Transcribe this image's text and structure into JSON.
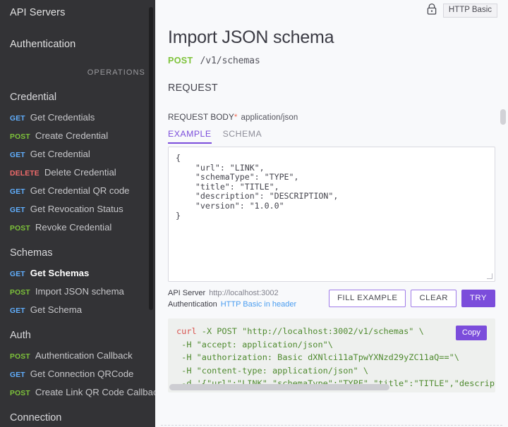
{
  "sidebar": {
    "top_items": [
      {
        "label": "API Servers"
      },
      {
        "label": "Authentication"
      }
    ],
    "operations_label": "OPERATIONS",
    "groups": [
      {
        "title": "Credential",
        "items": [
          {
            "verb": "GET",
            "label": "Get Credentials",
            "active": false
          },
          {
            "verb": "POST",
            "label": "Create Credential",
            "active": false
          },
          {
            "verb": "GET",
            "label": "Get Credential",
            "active": false
          },
          {
            "verb": "DELETE",
            "label": "Delete Credential",
            "active": false
          },
          {
            "verb": "GET",
            "label": "Get Credential QR code",
            "active": false
          },
          {
            "verb": "GET",
            "label": "Get Revocation Status",
            "active": false
          },
          {
            "verb": "POST",
            "label": "Revoke Credential",
            "active": false
          }
        ]
      },
      {
        "title": "Schemas",
        "items": [
          {
            "verb": "GET",
            "label": "Get Schemas",
            "active": true
          },
          {
            "verb": "POST",
            "label": "Import JSON schema",
            "active": false
          },
          {
            "verb": "GET",
            "label": "Get Schema",
            "active": false
          }
        ]
      },
      {
        "title": "Auth",
        "items": [
          {
            "verb": "POST",
            "label": "Authentication Callback",
            "active": false
          },
          {
            "verb": "GET",
            "label": "Get Connection QRCode",
            "active": false
          },
          {
            "verb": "POST",
            "label": "Create Link QR Code Callback",
            "active": false
          }
        ]
      },
      {
        "title": "Connection",
        "items": []
      }
    ]
  },
  "main": {
    "auth": {
      "icon": "lock-icon",
      "chip_label": "HTTP Basic"
    },
    "title": "Import JSON schema",
    "endpoint": {
      "method": "POST",
      "path": "/v1/schemas"
    },
    "request_heading": "REQUEST",
    "request_body": {
      "label": "REQUEST BODY",
      "required_marker": "*",
      "content_type": "application/json"
    },
    "tabs": [
      {
        "label": "EXAMPLE",
        "active": true
      },
      {
        "label": "SCHEMA",
        "active": false
      }
    ],
    "example_body": "{\n    \"url\": \"LINK\",\n    \"schemaType\": \"TYPE\",\n    \"title\": \"TITLE\",\n    \"description\": \"DESCRIPTION\",\n    \"version\": \"1.0.0\"\n}",
    "meta": {
      "server_label": "API Server",
      "server_value": "http://localhost:3002",
      "auth_label": "Authentication",
      "auth_value": "HTTP Basic in header"
    },
    "buttons": {
      "fill_example": "FILL EXAMPLE",
      "clear": "CLEAR",
      "try": "TRY"
    },
    "code": {
      "copy_label": "Copy",
      "line1_cmd": "curl",
      "line1_rest": " -X POST \"http://localhost:3002/v1/schemas\" \\",
      "line2": " -H \"accept: application/json\"\\",
      "line3": " -H \"authorization: Basic dXNlci11aTpwYXNzd29yZC11aQ==\"\\",
      "line4": " -H \"content-type: application/json\" \\",
      "line5": " -d '{\"url\":\"LINK\",\"schemaType\":\"TYPE\",\"title\":\"TITLE\",\"description\":"
    }
  },
  "colors": {
    "sidebar_bg": "#333336",
    "accent_purple": "#7b4ddb",
    "verb_get": "#61affe",
    "verb_post": "#7ec33a",
    "verb_delete": "#f26b6b",
    "code_green": "#4f8a2f",
    "code_red": "#d9534f",
    "link_blue": "#4a9df0"
  }
}
